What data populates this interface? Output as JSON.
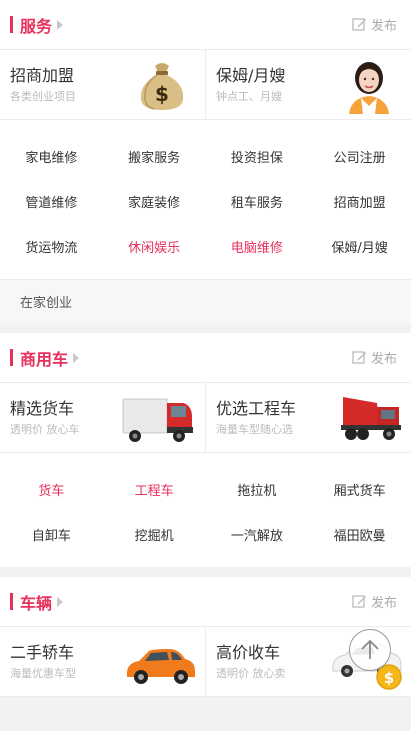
{
  "colors": {
    "accent": "#e7305c",
    "muted": "#bbbbbb",
    "text": "#333333"
  },
  "service": {
    "title": "服务",
    "publish_label": "发布",
    "promos": [
      {
        "title": "招商加盟",
        "subtitle": "各类创业项目",
        "icon": "money-bag-icon"
      },
      {
        "title": "保姆/月嫂",
        "subtitle": "钟点工、月嫂",
        "icon": "nanny-avatar"
      }
    ],
    "grid": [
      [
        "家电维修",
        "搬家服务",
        "投资担保",
        "公司注册"
      ],
      [
        "管道维修",
        "家庭装修",
        "租车服务",
        "招商加盟"
      ],
      [
        "货运物流",
        "休闲娱乐",
        "电脑维修",
        "保姆/月嫂"
      ]
    ],
    "extra_label": "在家创业"
  },
  "commercial": {
    "title": "商用车",
    "publish_label": "发布",
    "promos": [
      {
        "title": "精选货车",
        "subtitle": "透明价 放心车",
        "icon": "red-truck-icon"
      },
      {
        "title": "优选工程车",
        "subtitle": "海量车型随心选",
        "icon": "dump-truck-icon"
      }
    ],
    "grid": [
      [
        "货车",
        "工程车",
        "拖拉机",
        "厢式货车"
      ],
      [
        "自卸车",
        "挖掘机",
        "一汽解放",
        "福田欧曼"
      ]
    ]
  },
  "vehicles": {
    "title": "车辆",
    "publish_label": "发布",
    "promos": [
      {
        "title": "二手轿车",
        "subtitle": "海量优惠车型",
        "icon": "orange-car-icon"
      },
      {
        "title": "高价收车",
        "subtitle": "透明价 放心卖",
        "icon": "white-car-coin-icon"
      }
    ]
  },
  "scroll_top_icon": "arrow-up-icon"
}
